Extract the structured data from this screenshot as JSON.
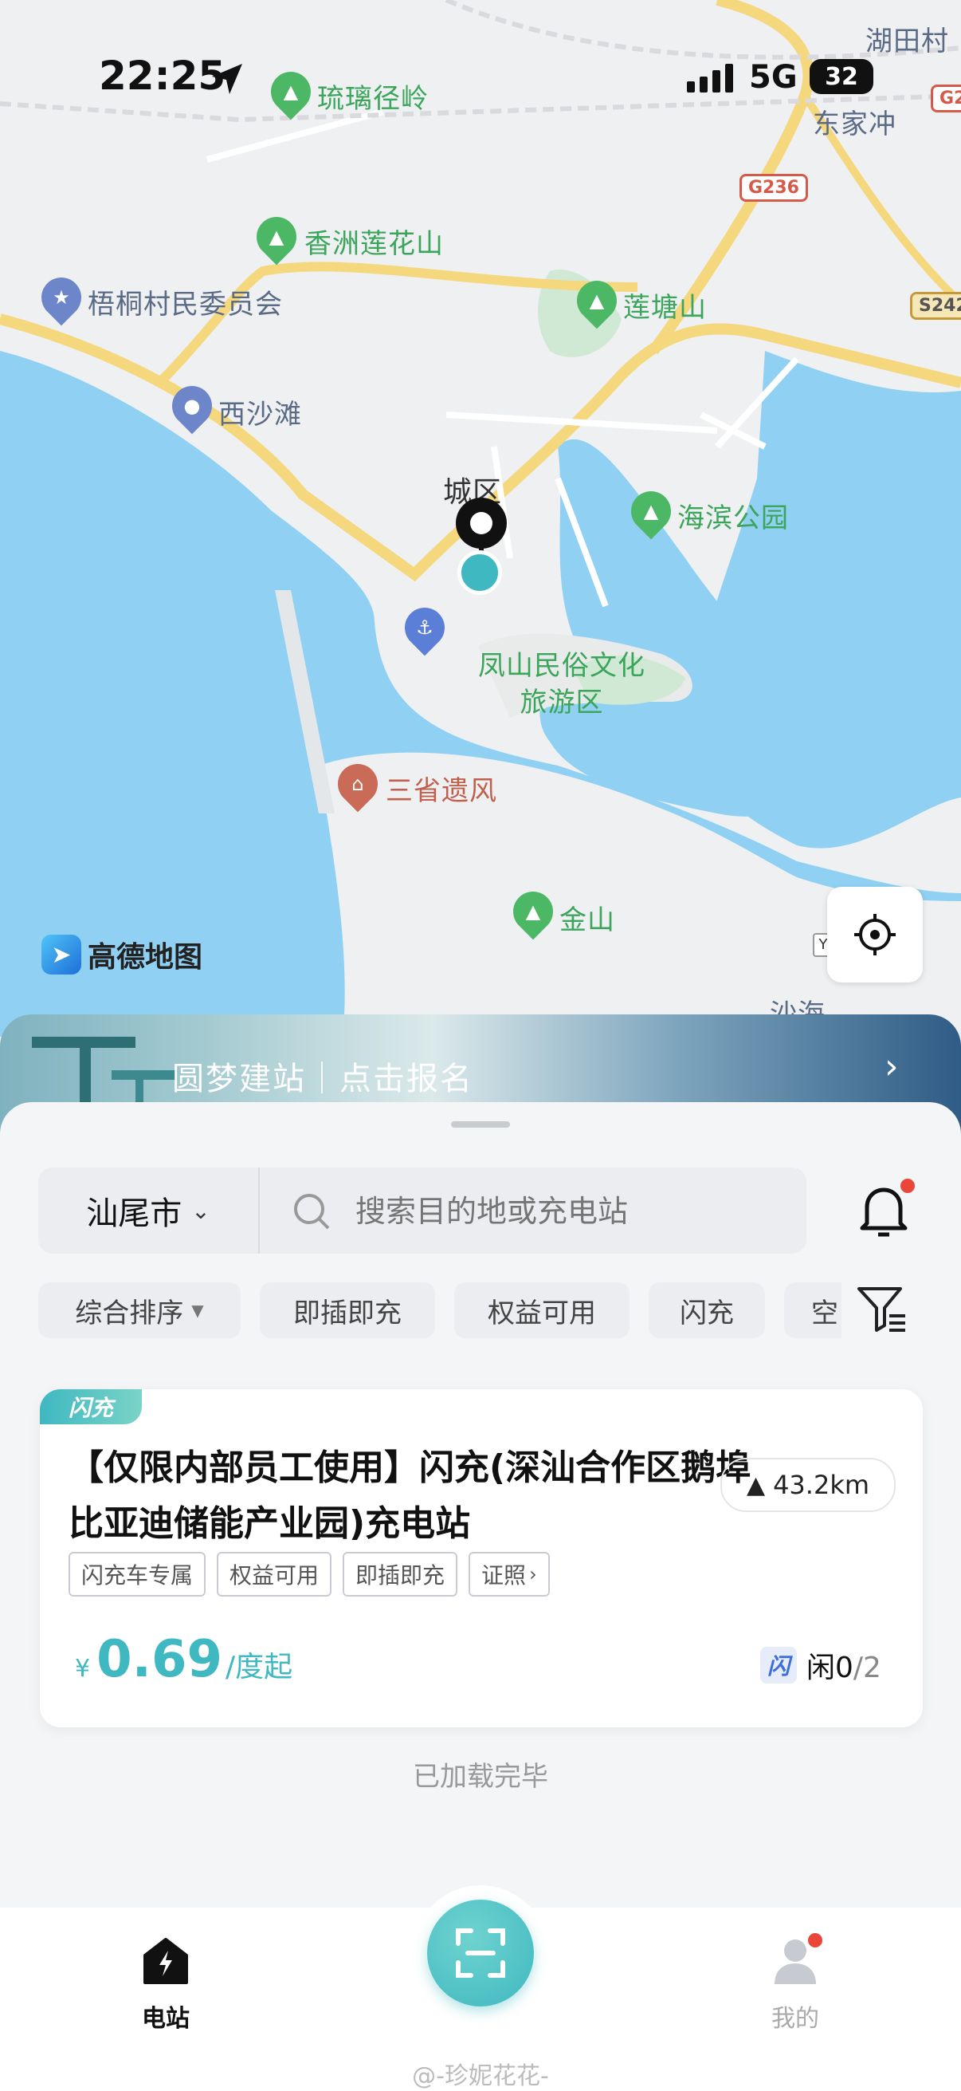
{
  "status_bar": {
    "time": "22:25",
    "network": "5G",
    "battery": "32"
  },
  "map": {
    "labels": {
      "hutian": "湖田村",
      "dongjiachong": "东家冲",
      "liuli": "琉璃径岭",
      "xiangzhou": "香洲莲花山",
      "wutong": "梧桐村民委员会",
      "liantang": "莲塘山",
      "xisha": "西沙滩",
      "chengqu": "城区",
      "haibin": "海滨公园",
      "fengshan": "凤山民俗文化旅游区",
      "sansheng": "三省遗风",
      "jinshan": "金山",
      "shahai": "沙海",
      "y_badge": "Y"
    },
    "road_badges": [
      "G236",
      "S242",
      "G2"
    ],
    "logo": "高德地图"
  },
  "banner": {
    "text": "圆梦建站｜点击报名"
  },
  "search": {
    "city": "汕尾市",
    "placeholder": "搜索目的地或充电站"
  },
  "filters": [
    "综合排序",
    "即插即充",
    "权益可用",
    "闪充",
    "空"
  ],
  "station": {
    "badge": "闪充",
    "title": "【仅限内部员工使用】闪充(深汕合作区鹅埠比亚迪储能产业园)充电站",
    "distance": "43.2km",
    "tags": [
      "闪充车专属",
      "权益可用",
      "即插即充",
      "证照"
    ],
    "currency": "¥",
    "price": "0.69",
    "price_unit": "/度起",
    "availability_label": "闲",
    "available": "0",
    "total": "/2"
  },
  "list_end": "已加载完毕",
  "tabs": {
    "station": "电站",
    "mine": "我的"
  },
  "watermark": "@-珍妮花花-",
  "colors": {
    "accent": "#3fb8c1",
    "badge_red": "#e8473a",
    "water": "#8fd0f3"
  }
}
